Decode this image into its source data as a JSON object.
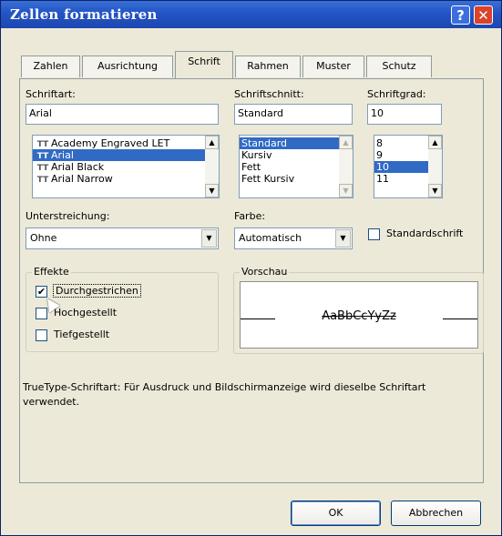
{
  "window": {
    "title": "Zellen formatieren",
    "help_glyph": "?",
    "close_glyph": "✕"
  },
  "tabs": [
    {
      "label": "Zahlen",
      "active": false
    },
    {
      "label": "Ausrichtung",
      "active": false
    },
    {
      "label": "Schrift",
      "active": true
    },
    {
      "label": "Rahmen",
      "active": false
    },
    {
      "label": "Muster",
      "active": false
    },
    {
      "label": "Schutz",
      "active": false
    }
  ],
  "font": {
    "label": "Schriftart:",
    "value": "Arial",
    "list": [
      {
        "name": "Academy Engraved LET",
        "truetype": true,
        "selected": false
      },
      {
        "name": "Arial",
        "truetype": true,
        "selected": true
      },
      {
        "name": "Arial Black",
        "truetype": true,
        "selected": false
      },
      {
        "name": "Arial Narrow",
        "truetype": true,
        "selected": false
      }
    ],
    "tt_glyph": "TT"
  },
  "style": {
    "label": "Schriftschnitt:",
    "value": "Standard",
    "list": [
      {
        "name": "Standard",
        "selected": true
      },
      {
        "name": "Kursiv",
        "selected": false
      },
      {
        "name": "Fett",
        "selected": false
      },
      {
        "name": "Fett Kursiv",
        "selected": false
      }
    ]
  },
  "size": {
    "label": "Schriftgrad:",
    "value": "10",
    "list": [
      {
        "name": "8",
        "selected": false
      },
      {
        "name": "9",
        "selected": false
      },
      {
        "name": "10",
        "selected": true
      },
      {
        "name": "11",
        "selected": false
      }
    ]
  },
  "underline": {
    "label": "Unterstreichung:",
    "value": "Ohne"
  },
  "color": {
    "label": "Farbe:",
    "value": "Automatisch"
  },
  "standard_font": {
    "label": "Standardschrift",
    "checked": false
  },
  "effects": {
    "title": "Effekte",
    "items": [
      {
        "label": "Durchgestrichen",
        "checked": true
      },
      {
        "label": "Hochgestellt",
        "checked": false
      },
      {
        "label": "Tiefgestellt",
        "checked": false
      }
    ]
  },
  "preview": {
    "title": "Vorschau",
    "sample": "AaBbCcYyZz"
  },
  "description": "TrueType-Schriftart: Für Ausdruck und Bildschirmanzeige wird dieselbe Schriftart verwendet.",
  "buttons": {
    "ok": "OK",
    "cancel": "Abbrechen"
  },
  "icons": {
    "scroll_up": "▲",
    "scroll_down": "▼",
    "checkmark": "✔"
  },
  "colors": {
    "title_bar": "#2456c6",
    "selection": "#316ac5",
    "close_button": "#d9442b",
    "dialog_bg": "#ece9d8"
  }
}
